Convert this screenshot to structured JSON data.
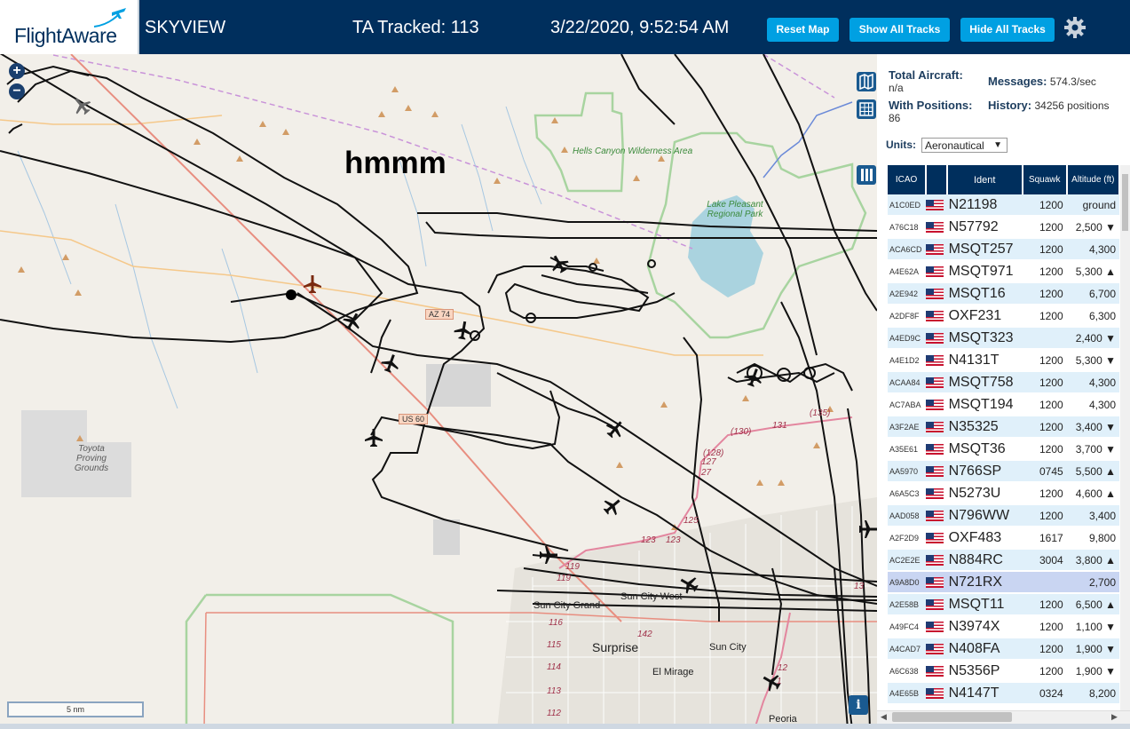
{
  "header": {
    "logo_text": "FlightAware",
    "title": "SKYVIEW",
    "tracked": "TA Tracked: 113",
    "datetime": "3/22/2020, 9:52:54 AM",
    "buttons": [
      "Reset Map",
      "Show All Tracks",
      "Hide All Tracks"
    ],
    "settings_icon": "gear-icon"
  },
  "colors": {
    "header_bg": "#002f5d",
    "button_bg": "#00a0e2",
    "row_bg": "#e0f0fa",
    "selected_row_bg": "#c9d5f2"
  },
  "map": {
    "annotation": "hmmm",
    "scale": "5 nm",
    "zoom_in": "+",
    "zoom_out": "−",
    "info": "i",
    "labels": {
      "hells_canyon": "Hells Canyon Wilderness Area",
      "lake_pleasant": "Lake Pleasant Regional Park",
      "toyota": "Toyota Proving Grounds",
      "az74": "AZ 74",
      "us60": "US 60",
      "sun_city_grand": "Sun City Grand",
      "sun_city_west": "Sun City West",
      "surprise": "Surprise",
      "sun_city": "Sun City",
      "el_mirage": "El Mirage",
      "peoria": "Peoria"
    },
    "road_numbers": [
      "(135)",
      "(130)",
      "131",
      "(128)",
      "127",
      "27",
      "125",
      "123",
      "123",
      "119",
      "119",
      "116",
      "115",
      "114",
      "113",
      "112",
      "142",
      "12",
      "1",
      "13"
    ]
  },
  "stats": {
    "total_aircraft_label": "Total Aircraft:",
    "total_aircraft_value": "n/a",
    "with_positions_label": "With Positions:",
    "with_positions_value": "86",
    "messages_label": "Messages:",
    "messages_value": "574.3/sec",
    "history_label": "History:",
    "history_value": "34256 positions"
  },
  "units": {
    "label": "Units:",
    "selected": "Aeronautical"
  },
  "table": {
    "headers": [
      "ICAO",
      "",
      "Ident",
      "Squawk",
      "Altitude (ft)"
    ],
    "rows": [
      {
        "icao": "A1C0ED",
        "ident": "N21198",
        "squawk": "1200",
        "altitude": "ground"
      },
      {
        "icao": "A76C18",
        "ident": "N57792",
        "squawk": "1200",
        "altitude": "2,500 ▼"
      },
      {
        "icao": "ACA6CD",
        "ident": "MSQT257",
        "squawk": "1200",
        "altitude": "4,300"
      },
      {
        "icao": "A4E62A",
        "ident": "MSQT971",
        "squawk": "1200",
        "altitude": "5,300 ▲"
      },
      {
        "icao": "A2E942",
        "ident": "MSQT16",
        "squawk": "1200",
        "altitude": "6,700"
      },
      {
        "icao": "A2DF8F",
        "ident": "OXF231",
        "squawk": "1200",
        "altitude": "6,300"
      },
      {
        "icao": "A4ED9C",
        "ident": "MSQT323",
        "squawk": "",
        "altitude": "2,400 ▼"
      },
      {
        "icao": "A4E1D2",
        "ident": "N4131T",
        "squawk": "1200",
        "altitude": "5,300 ▼"
      },
      {
        "icao": "ACAA84",
        "ident": "MSQT758",
        "squawk": "1200",
        "altitude": "4,300"
      },
      {
        "icao": "AC7ABA",
        "ident": "MSQT194",
        "squawk": "1200",
        "altitude": "4,300"
      },
      {
        "icao": "A3F2AE",
        "ident": "N35325",
        "squawk": "1200",
        "altitude": "3,400 ▼"
      },
      {
        "icao": "A35E61",
        "ident": "MSQT36",
        "squawk": "1200",
        "altitude": "3,700 ▼"
      },
      {
        "icao": "AA5970",
        "ident": "N766SP",
        "squawk": "0745",
        "altitude": "5,500 ▲"
      },
      {
        "icao": "A6A5C3",
        "ident": "N5273U",
        "squawk": "1200",
        "altitude": "4,600 ▲"
      },
      {
        "icao": "AAD058",
        "ident": "N796WW",
        "squawk": "1200",
        "altitude": "3,400"
      },
      {
        "icao": "A2F2D9",
        "ident": "OXF483",
        "squawk": "1617",
        "altitude": "9,800"
      },
      {
        "icao": "AC2E2E",
        "ident": "N884RC",
        "squawk": "3004",
        "altitude": "3,800 ▲"
      },
      {
        "icao": "A9A8D0",
        "ident": "N721RX",
        "squawk": "",
        "altitude": "2,700"
      },
      {
        "icao": "A2E58B",
        "ident": "MSQT11",
        "squawk": "1200",
        "altitude": "6,500 ▲"
      },
      {
        "icao": "A49FC4",
        "ident": "N3974X",
        "squawk": "1200",
        "altitude": "1,100 ▼"
      },
      {
        "icao": "A4CAD7",
        "ident": "N408FA",
        "squawk": "1200",
        "altitude": "1,900 ▼"
      },
      {
        "icao": "A6C638",
        "ident": "N5356P",
        "squawk": "1200",
        "altitude": "1,900 ▼"
      },
      {
        "icao": "A4E65B",
        "ident": "N4147T",
        "squawk": "0324",
        "altitude": "8,200"
      }
    ]
  }
}
